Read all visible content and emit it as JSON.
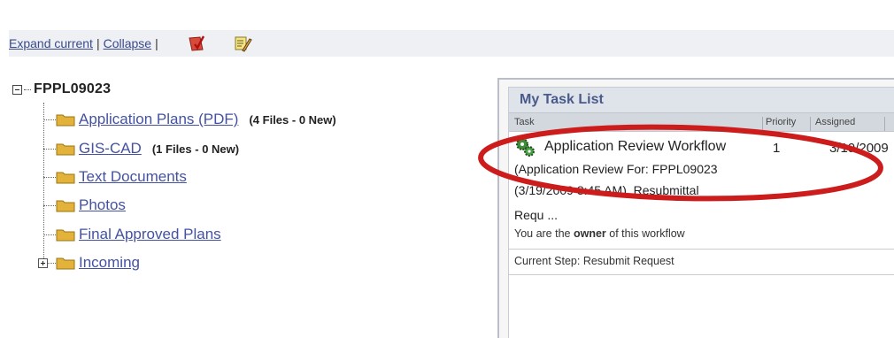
{
  "toolbar": {
    "expand_label": "Expand current",
    "sep1": "|",
    "collapse_label": "Collapse",
    "sep2": "|"
  },
  "tree": {
    "root_label": "FPPL09023",
    "items": [
      {
        "label": "Application Plans (PDF)",
        "count": "(4 Files - 0 New)"
      },
      {
        "label": "GIS-CAD",
        "count": "(1 Files - 0 New)"
      },
      {
        "label": "Text Documents",
        "count": ""
      },
      {
        "label": "Photos",
        "count": ""
      },
      {
        "label": "Final Approved Plans",
        "count": ""
      },
      {
        "label": "Incoming",
        "count": ""
      }
    ]
  },
  "task_panel": {
    "title": "My Task List",
    "columns": {
      "task": "Task",
      "priority": "Priority",
      "assigned": "Assigned"
    },
    "task": {
      "name": "Application Review Workflow",
      "priority": "1",
      "assigned": "3/19/2009",
      "desc_line1": "(Application Review For: FPPL09023",
      "desc_line2": "(3/19/2009 8:45 AM), Resubmittal",
      "desc_line3": "Requ ...",
      "owner_pre": "You are the ",
      "owner_word": "owner",
      "owner_post": " of this workflow",
      "current_step": "Current Step: Resubmit Request"
    }
  },
  "annotation": {
    "ellipse_color": "#cc1c1c"
  },
  "colors": {
    "link": "#4452a0",
    "panel_title": "#4a5a8a",
    "folder": "#e2b23a"
  }
}
